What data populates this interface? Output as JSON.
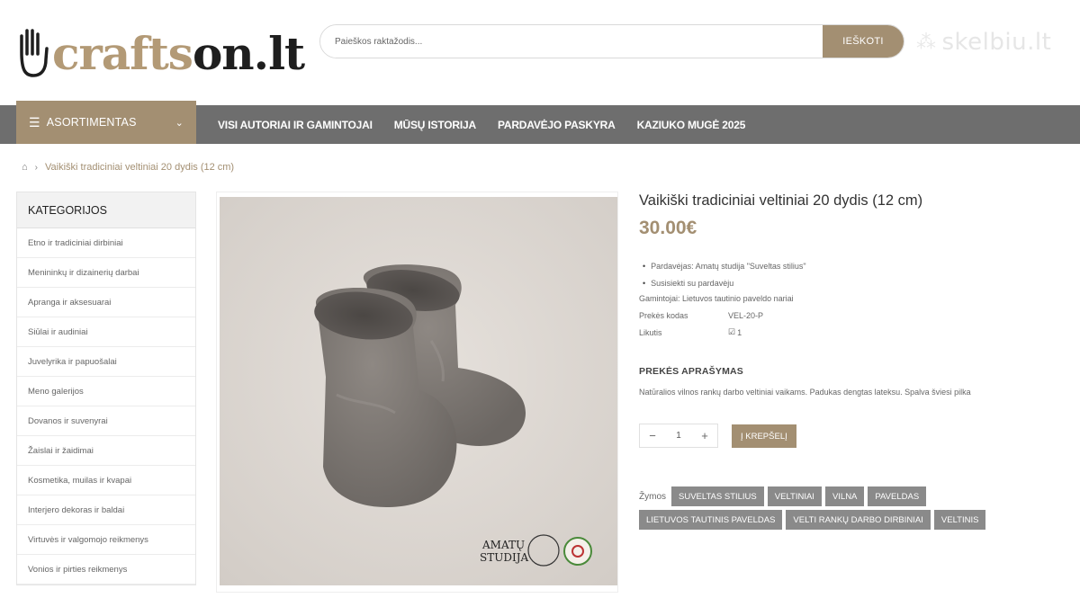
{
  "logo": {
    "part_a": "crafts",
    "part_b": "on.lt"
  },
  "search": {
    "placeholder": "Paieškos raktažodis...",
    "button": "IEŠKOTI"
  },
  "partner": {
    "name": "skelbiu.lt"
  },
  "nav": {
    "assortment": "ASORTIMENTAS",
    "links": [
      "VISI AUTORIAI IR GAMINTOJAI",
      "MŪSŲ ISTORIJA",
      "PARDAVĖJO PASKYRA",
      "KAZIUKO MUGĖ 2025"
    ]
  },
  "breadcrumb": {
    "current": "Vaikiški tradiciniai veltiniai 20 dydis (12 cm)"
  },
  "sidebar": {
    "title": "KATEGORIJOS",
    "items": [
      "Etno ir tradiciniai dirbiniai",
      "Menininkų ir dizainerių darbai",
      "Apranga ir aksesuarai",
      "Siūlai ir audiniai",
      "Juvelyrika ir papuošalai",
      "Meno galerijos",
      "Dovanos ir suvenyrai",
      "Žaislai ir žaidimai",
      "Kosmetika, muilas ir kvapai",
      "Interjero dekoras ir baldai",
      "Virtuvės ir valgomojo reikmenys",
      "Vonios ir pirties reikmenys"
    ]
  },
  "image": {
    "watermark_line1": "AMATŲ",
    "watermark_line2": "STUDIJA"
  },
  "product": {
    "title": "Vaikiški tradiciniai veltiniai 20 dydis (12 cm)",
    "price": "30.00€",
    "seller": "Pardavėjas: Amatų studija \"Suveltas stilius\"",
    "contact": "Susisiekti su pardavėju",
    "maker": "Gamintojai: Lietuvos tautinio paveldo nariai",
    "code_label": "Prekės kodas",
    "code_value": "VEL-20-P",
    "stock_label": "Likutis",
    "stock_value": "1",
    "desc_heading": "PREKĖS APRAŠYMAS",
    "description": "Natūralios vilnos rankų darbo veltiniai vaikams. Padukas dengtas lateksu. Spalva šviesi pilka",
    "qty": "1",
    "qty_minus": "−",
    "qty_plus": "+",
    "cart_button": "Į KREPŠELĮ",
    "tags_label": "Žymos",
    "tags": [
      "SUVELTAS STILIUS",
      "VELTINIAI",
      "VILNA",
      "PAVELDAS",
      "LIETUVOS TAUTINIS PAVELDAS",
      "VELTI RANKŲ DARBO DIRBINIAI",
      "VELTINIS"
    ]
  },
  "colors": {
    "accent": "#a38f72",
    "nav": "#6e6e6e",
    "tag": "#8a8a8a"
  }
}
